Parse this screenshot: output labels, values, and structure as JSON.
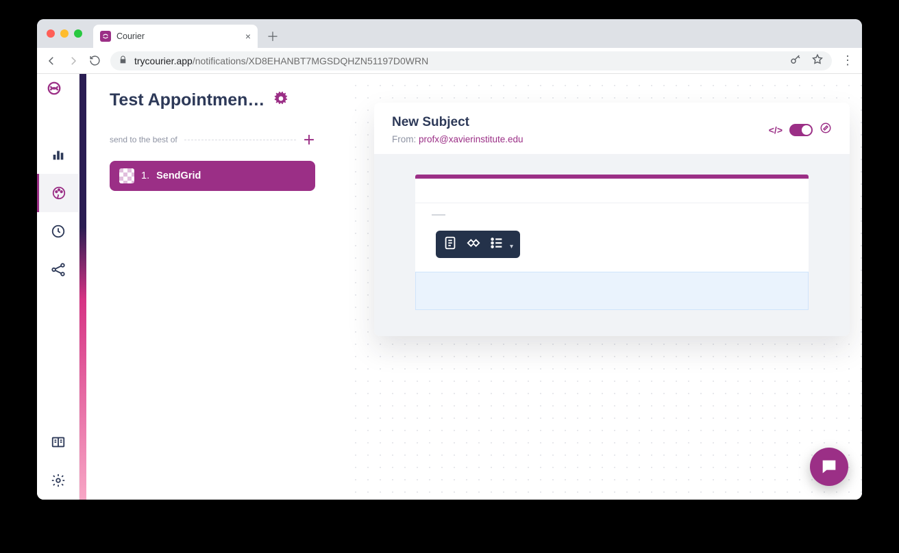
{
  "browser": {
    "tab_title": "Courier",
    "url_host": "trycourier.app",
    "url_path": "/notifications/XD8EHANBT7MGSDQHZN51197D0WRN"
  },
  "sidebar": {
    "items": [
      {
        "name": "analytics"
      },
      {
        "name": "designer",
        "active": true
      },
      {
        "name": "history"
      },
      {
        "name": "integrations"
      }
    ],
    "footer": [
      {
        "name": "docs"
      },
      {
        "name": "settings"
      }
    ]
  },
  "page": {
    "title": "Test Appointmen…",
    "send_label": "send to the best of"
  },
  "channel": {
    "index": "1.",
    "name": "SendGrid"
  },
  "editor": {
    "subject": "New Subject",
    "from_label": "From:",
    "from_value": "profx@xavierinstitute.edu"
  }
}
